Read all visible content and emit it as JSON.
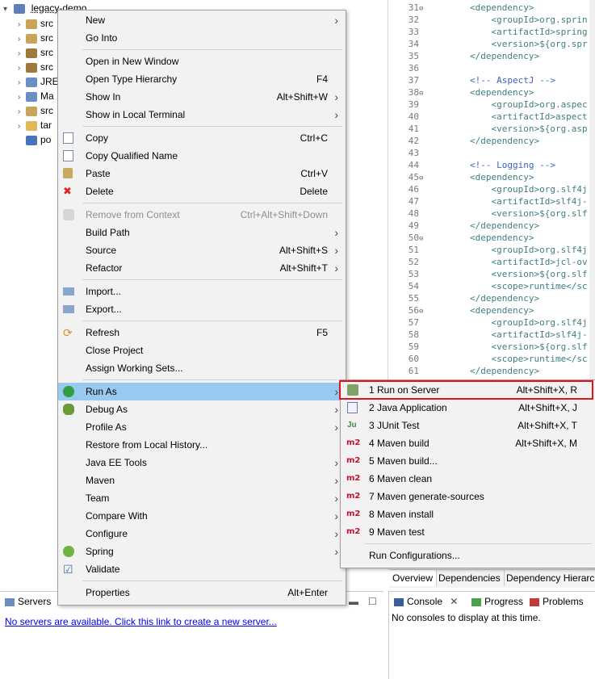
{
  "explorer": {
    "project": "legacy-demo",
    "items": [
      {
        "label": "src",
        "icon_color": "#c8a45a"
      },
      {
        "label": "src",
        "icon_color": "#c8a45a"
      },
      {
        "label": "src",
        "icon_color": "#9c7a3c"
      },
      {
        "label": "src",
        "icon_color": "#9c7a3c"
      },
      {
        "label": "JRE",
        "icon_color": "#6a8fc2"
      },
      {
        "label": "Ma",
        "icon_color": "#6a8fc2"
      },
      {
        "label": "src",
        "icon_color": "#c8a45a"
      },
      {
        "label": "tar",
        "icon_color": "#e0b858"
      },
      {
        "label": "po",
        "icon_color": "#4a74b8"
      }
    ]
  },
  "editor": {
    "lines": [
      {
        "n": "31",
        "fold": true,
        "text": "        <dependency>",
        "kind": "tag"
      },
      {
        "n": "32",
        "fold": false,
        "text": "            <groupId>org.sprin",
        "kind": "tag"
      },
      {
        "n": "33",
        "fold": false,
        "text": "            <artifactId>spring",
        "kind": "tag"
      },
      {
        "n": "34",
        "fold": false,
        "text": "            <version>${org.spr",
        "kind": "tag"
      },
      {
        "n": "35",
        "fold": false,
        "text": "        </dependency>",
        "kind": "tag"
      },
      {
        "n": "36",
        "fold": false,
        "text": "",
        "kind": "tag"
      },
      {
        "n": "37",
        "fold": false,
        "text": "        <!-- AspectJ -->",
        "kind": "cmt"
      },
      {
        "n": "38",
        "fold": true,
        "text": "        <dependency>",
        "kind": "tag"
      },
      {
        "n": "39",
        "fold": false,
        "text": "            <groupId>org.aspec",
        "kind": "tag"
      },
      {
        "n": "40",
        "fold": false,
        "text": "            <artifactId>aspect",
        "kind": "tag"
      },
      {
        "n": "41",
        "fold": false,
        "text": "            <version>${org.asp",
        "kind": "tag"
      },
      {
        "n": "42",
        "fold": false,
        "text": "        </dependency>",
        "kind": "tag"
      },
      {
        "n": "43",
        "fold": false,
        "text": "",
        "kind": "tag"
      },
      {
        "n": "44",
        "fold": false,
        "text": "        <!-- Logging -->",
        "kind": "cmt"
      },
      {
        "n": "45",
        "fold": true,
        "text": "        <dependency>",
        "kind": "tag"
      },
      {
        "n": "46",
        "fold": false,
        "text": "            <groupId>org.slf4j",
        "kind": "tag"
      },
      {
        "n": "47",
        "fold": false,
        "text": "            <artifactId>slf4j-",
        "kind": "tag"
      },
      {
        "n": "48",
        "fold": false,
        "text": "            <version>${org.slf",
        "kind": "tag"
      },
      {
        "n": "49",
        "fold": false,
        "text": "        </dependency>",
        "kind": "tag"
      },
      {
        "n": "50",
        "fold": true,
        "text": "        <dependency>",
        "kind": "tag"
      },
      {
        "n": "51",
        "fold": false,
        "text": "            <groupId>org.slf4j",
        "kind": "tag"
      },
      {
        "n": "52",
        "fold": false,
        "text": "            <artifactId>jcl-ov",
        "kind": "tag"
      },
      {
        "n": "53",
        "fold": false,
        "text": "            <version>${org.slf",
        "kind": "tag"
      },
      {
        "n": "54",
        "fold": false,
        "text": "            <scope>runtime</sc",
        "kind": "tag"
      },
      {
        "n": "55",
        "fold": false,
        "text": "        </dependency>",
        "kind": "tag"
      },
      {
        "n": "56",
        "fold": true,
        "text": "        <dependency>",
        "kind": "tag"
      },
      {
        "n": "57",
        "fold": false,
        "text": "            <groupId>org.slf4j",
        "kind": "tag"
      },
      {
        "n": "58",
        "fold": false,
        "text": "            <artifactId>slf4j-",
        "kind": "tag"
      },
      {
        "n": "59",
        "fold": false,
        "text": "            <version>${org.slf",
        "kind": "tag"
      },
      {
        "n": "60",
        "fold": false,
        "text": "            <scope>runtime</sc",
        "kind": "tag"
      },
      {
        "n": "61",
        "fold": false,
        "text": "        </dependency>",
        "kind": "tag"
      }
    ],
    "tabs": [
      "Overview",
      "Dependencies",
      "Dependency Hierarc"
    ]
  },
  "servers_panel": {
    "tab": "Servers",
    "link": "No servers are available. Click this link to create a new server..."
  },
  "console_panel": {
    "tabs": [
      "Console",
      "Progress",
      "Problems"
    ],
    "message": "No consoles to display at this time."
  },
  "context_menu": {
    "items": [
      {
        "label": "New",
        "shortcut": "",
        "sub": true
      },
      {
        "label": "Go Into",
        "shortcut": "",
        "sub": false
      },
      {
        "sep": true
      },
      {
        "label": "Open in New Window",
        "shortcut": "",
        "sub": false
      },
      {
        "label": "Open Type Hierarchy",
        "shortcut": "F4",
        "sub": false
      },
      {
        "label": "Show In",
        "shortcut": "Alt+Shift+W",
        "sub": true
      },
      {
        "label": "Show in Local Terminal",
        "shortcut": "",
        "sub": true
      },
      {
        "sep": true
      },
      {
        "label": "Copy",
        "shortcut": "Ctrl+C",
        "sub": false,
        "icon": "copy-icon"
      },
      {
        "label": "Copy Qualified Name",
        "shortcut": "",
        "sub": false,
        "icon": "copy-qualified-icon"
      },
      {
        "label": "Paste",
        "shortcut": "Ctrl+V",
        "sub": false,
        "icon": "paste-icon"
      },
      {
        "label": "Delete",
        "shortcut": "Delete",
        "sub": false,
        "icon": "delete-icon"
      },
      {
        "sep": true
      },
      {
        "label": "Remove from Context",
        "shortcut": "Ctrl+Alt+Shift+Down",
        "sub": false,
        "disabled": true,
        "icon": "remove-context-icon"
      },
      {
        "label": "Build Path",
        "shortcut": "",
        "sub": true
      },
      {
        "label": "Source",
        "shortcut": "Alt+Shift+S",
        "sub": true
      },
      {
        "label": "Refactor",
        "shortcut": "Alt+Shift+T",
        "sub": true
      },
      {
        "sep": true
      },
      {
        "label": "Import...",
        "shortcut": "",
        "sub": false,
        "icon": "import-icon"
      },
      {
        "label": "Export...",
        "shortcut": "",
        "sub": false,
        "icon": "export-icon"
      },
      {
        "sep": true
      },
      {
        "label": "Refresh",
        "shortcut": "F5",
        "sub": false,
        "icon": "refresh-icon"
      },
      {
        "label": "Close Project",
        "shortcut": "",
        "sub": false
      },
      {
        "label": "Assign Working Sets...",
        "shortcut": "",
        "sub": false
      },
      {
        "sep": true
      },
      {
        "label": "Run As",
        "shortcut": "",
        "sub": true,
        "highlight": true,
        "icon": "run-icon"
      },
      {
        "label": "Debug As",
        "shortcut": "",
        "sub": true,
        "icon": "debug-icon"
      },
      {
        "label": "Profile As",
        "shortcut": "",
        "sub": true
      },
      {
        "label": "Restore from Local History...",
        "shortcut": "",
        "sub": false
      },
      {
        "label": "Java EE Tools",
        "shortcut": "",
        "sub": true
      },
      {
        "label": "Maven",
        "shortcut": "",
        "sub": true
      },
      {
        "label": "Team",
        "shortcut": "",
        "sub": true
      },
      {
        "label": "Compare With",
        "shortcut": "",
        "sub": true
      },
      {
        "label": "Configure",
        "shortcut": "",
        "sub": true
      },
      {
        "label": "Spring",
        "shortcut": "",
        "sub": true,
        "icon": "spring-icon"
      },
      {
        "label": "Validate",
        "shortcut": "",
        "sub": false,
        "icon": "validate-icon"
      },
      {
        "sep": true
      },
      {
        "label": "Properties",
        "shortcut": "Alt+Enter",
        "sub": false
      }
    ]
  },
  "run_as_menu": {
    "items": [
      {
        "label": "1 Run on Server",
        "shortcut": "Alt+Shift+X, R",
        "icon": "run-on-server-icon"
      },
      {
        "label": "2 Java Application",
        "shortcut": "Alt+Shift+X, J",
        "icon": "java-app-icon"
      },
      {
        "label": "3 JUnit Test",
        "shortcut": "Alt+Shift+X, T",
        "icon": "junit-icon"
      },
      {
        "label": "4 Maven build",
        "shortcut": "Alt+Shift+X, M",
        "icon": "maven-icon"
      },
      {
        "label": "5 Maven build...",
        "shortcut": "",
        "icon": "maven-icon"
      },
      {
        "label": "6 Maven clean",
        "shortcut": "",
        "icon": "maven-icon"
      },
      {
        "label": "7 Maven generate-sources",
        "shortcut": "",
        "icon": "maven-icon"
      },
      {
        "label": "8 Maven install",
        "shortcut": "",
        "icon": "maven-icon"
      },
      {
        "label": "9 Maven test",
        "shortcut": "",
        "icon": "maven-icon"
      },
      {
        "sep": true
      },
      {
        "label": "Run Configurations...",
        "shortcut": ""
      }
    ],
    "m2_text": "m2",
    "highlight_color": "#e0141e"
  },
  "colors": {
    "menu_bg": "#f2f2f2",
    "menu_highlight": "#99c9ef",
    "outline": "#e0141e"
  }
}
